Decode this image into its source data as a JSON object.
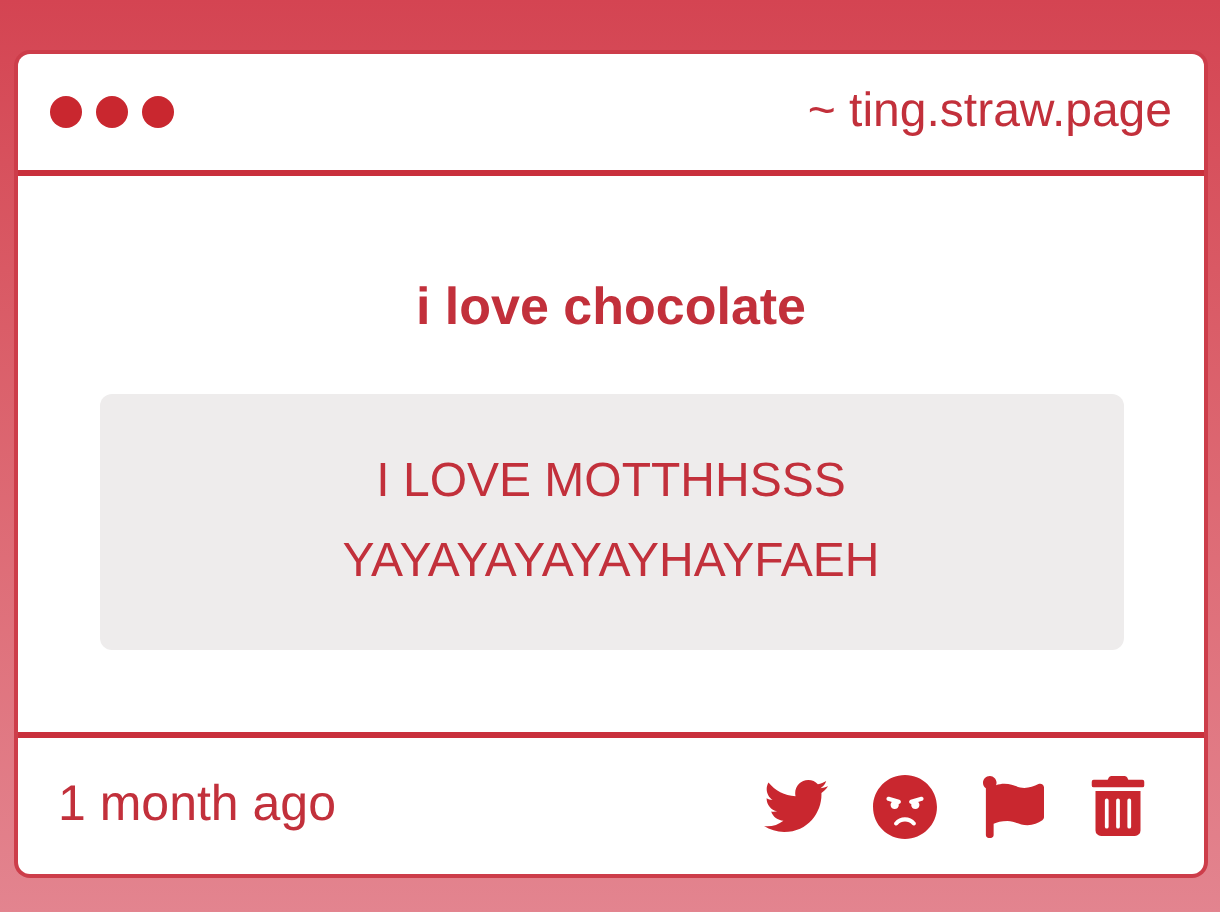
{
  "header": {
    "url": "~ ting.straw.page"
  },
  "post": {
    "title": "i love chocolate",
    "message": "I LOVE MOTTHHSSS YAYAYAYAYAYHAYFAEH"
  },
  "footer": {
    "time": "1 month ago"
  }
}
